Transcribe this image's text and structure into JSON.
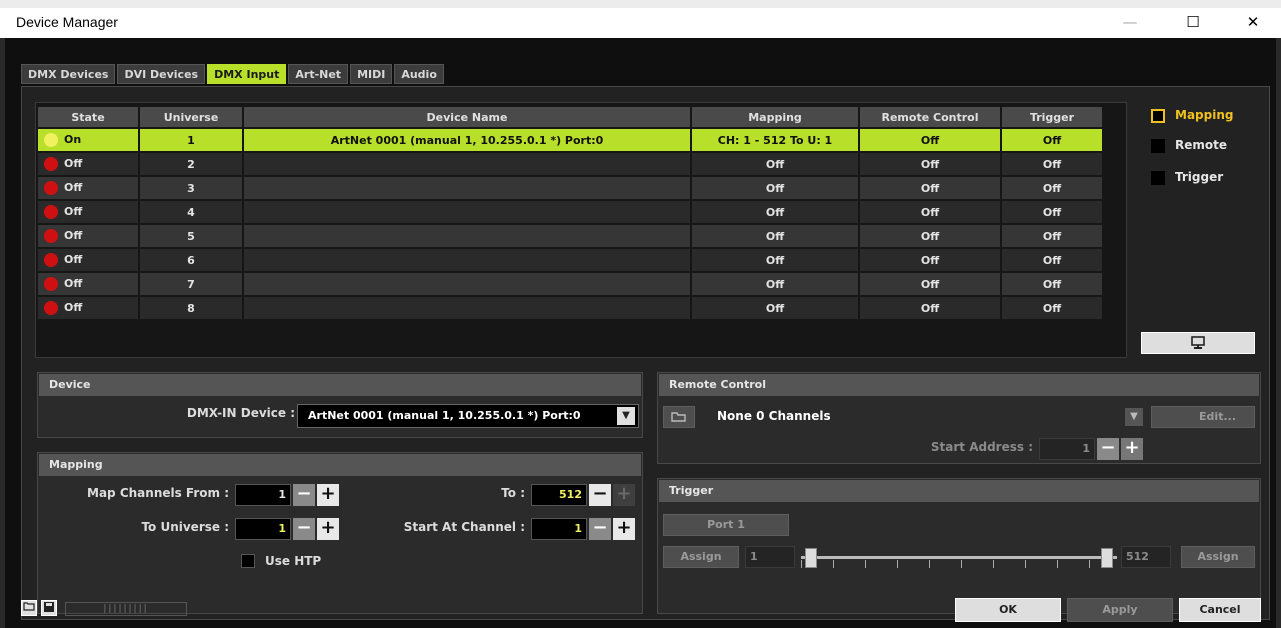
{
  "window": {
    "title": "Device Manager",
    "minimize": "—",
    "maximize": "☐",
    "close": "✕"
  },
  "tabs": [
    "DMX Devices",
    "DVI Devices",
    "DMX Input",
    "Art-Net",
    "MIDI",
    "Audio"
  ],
  "active_tab": "DMX Input",
  "table": {
    "headers": [
      "State",
      "Universe",
      "Device Name",
      "Mapping",
      "Remote Control",
      "Trigger"
    ],
    "rows": [
      {
        "state": "On",
        "universe": "1",
        "device": "ArtNet 0001 (manual 1, 10.255.0.1 *) Port:0",
        "mapping": "CH: 1 - 512 To U: 1",
        "remote": "Off",
        "trigger": "Off"
      },
      {
        "state": "Off",
        "universe": "2",
        "device": "",
        "mapping": "Off",
        "remote": "Off",
        "trigger": "Off"
      },
      {
        "state": "Off",
        "universe": "3",
        "device": "",
        "mapping": "Off",
        "remote": "Off",
        "trigger": "Off"
      },
      {
        "state": "Off",
        "universe": "4",
        "device": "",
        "mapping": "Off",
        "remote": "Off",
        "trigger": "Off"
      },
      {
        "state": "Off",
        "universe": "5",
        "device": "",
        "mapping": "Off",
        "remote": "Off",
        "trigger": "Off"
      },
      {
        "state": "Off",
        "universe": "6",
        "device": "",
        "mapping": "Off",
        "remote": "Off",
        "trigger": "Off"
      },
      {
        "state": "Off",
        "universe": "7",
        "device": "",
        "mapping": "Off",
        "remote": "Off",
        "trigger": "Off"
      },
      {
        "state": "Off",
        "universe": "8",
        "device": "",
        "mapping": "Off",
        "remote": "Off",
        "trigger": "Off"
      }
    ]
  },
  "legend": {
    "mapping": "Mapping",
    "remote": "Remote",
    "trigger": "Trigger",
    "monitor_icon": "monitor-icon"
  },
  "device": {
    "header": "Device",
    "dmx_in_label": "DMX-IN Device :",
    "dmx_in_value": "ArtNet 0001 (manual 1, 10.255.0.1 *) Port:0"
  },
  "mapping": {
    "header": "Mapping",
    "map_from_label": "Map Channels From :",
    "map_from_value": "1",
    "to_label": "To :",
    "to_value": "512",
    "to_universe_label": "To Universe :",
    "to_universe_value": "1",
    "start_label": "Start At Channel :",
    "start_value": "1",
    "use_htp": "Use HTP"
  },
  "remote": {
    "header": "Remote Control",
    "preset_value": "None  0 Channels",
    "edit": "Edit...",
    "start_address_label": "Start Address :",
    "start_address_value": "1"
  },
  "trigger": {
    "header": "Trigger",
    "port": "Port 1",
    "assign_left": "Assign",
    "range_min": "1",
    "range_max": "512",
    "assign_right": "Assign"
  },
  "bottom": {
    "ok": "OK",
    "apply": "Apply",
    "cancel": "Cancel",
    "ruler": "|||||||||"
  },
  "colors": {
    "accent": "#b8e02a",
    "on_dot": "#f0f060",
    "off_dot": "#d01010",
    "legend_mapping": "#f0c020"
  }
}
